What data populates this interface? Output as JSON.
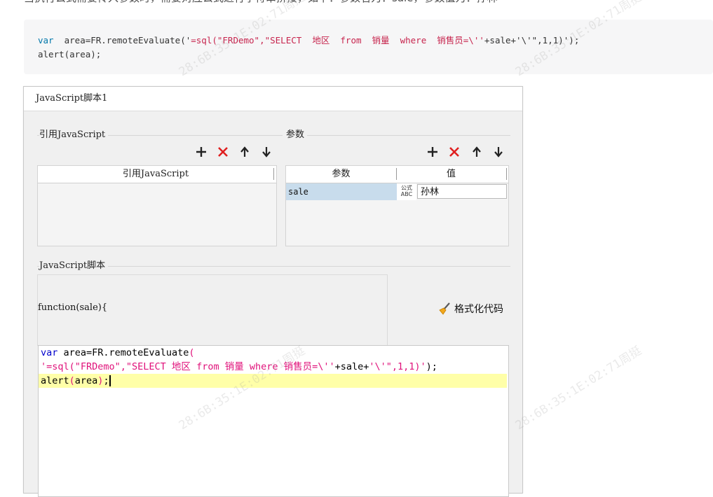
{
  "intro_text": "当执行公式需要传入参数时，需要对应公式进行字符串拼接，如下：参数名为：sale，参数值为：孙林",
  "code_snippet": {
    "line1_kw": "var",
    "line1_rest": "  area=FR.remoteEvaluate('",
    "line1_str": "=sql(\"FRDemo\",\"SELECT  地区  from  销量  where  销售员=\\''",
    "line1_tail": "+sale+'\\'\",1,1)');",
    "line2": "alert(area);"
  },
  "dialog": {
    "title": "JavaScript脚本1",
    "ref_section": {
      "legend": "引用JavaScript",
      "column_header": "引用JavaScript"
    },
    "param_section": {
      "legend": "参数",
      "columns": [
        "参数",
        "值"
      ],
      "rows": [
        {
          "name": "sale",
          "type_label_top": "公式",
          "type_label_bottom": "ABC",
          "value": "孙林"
        }
      ]
    },
    "script_section": {
      "legend": "JavaScript脚本",
      "function_signature": "function(sale){",
      "format_button_label": "格式化代码",
      "editor_lines": {
        "l1_kw": "var",
        "l1_id": " area=FR.remoteEvaluate",
        "l1_paren": "(",
        "l2_str": "'=sql(\"FRDemo\",\"SELECT 地区 from 销量 where 销售员=\\''",
        "l2_id": "+sale+",
        "l2_str2": "'\\'\",1,1)'",
        "l2_end": ");",
        "l3_id": "alert",
        "l3_paren": "(",
        "l3_arg": "area",
        "l3_paren2": ")",
        "l3_end": ";"
      }
    }
  },
  "watermark": "28:6B:35:1E:02:71周挺",
  "colors": {
    "keyword": "#0000cc",
    "string": "#e0117a",
    "current_line": "#ffffa8",
    "selected_param": "#c8dcec",
    "delete_icon": "#e02020"
  }
}
